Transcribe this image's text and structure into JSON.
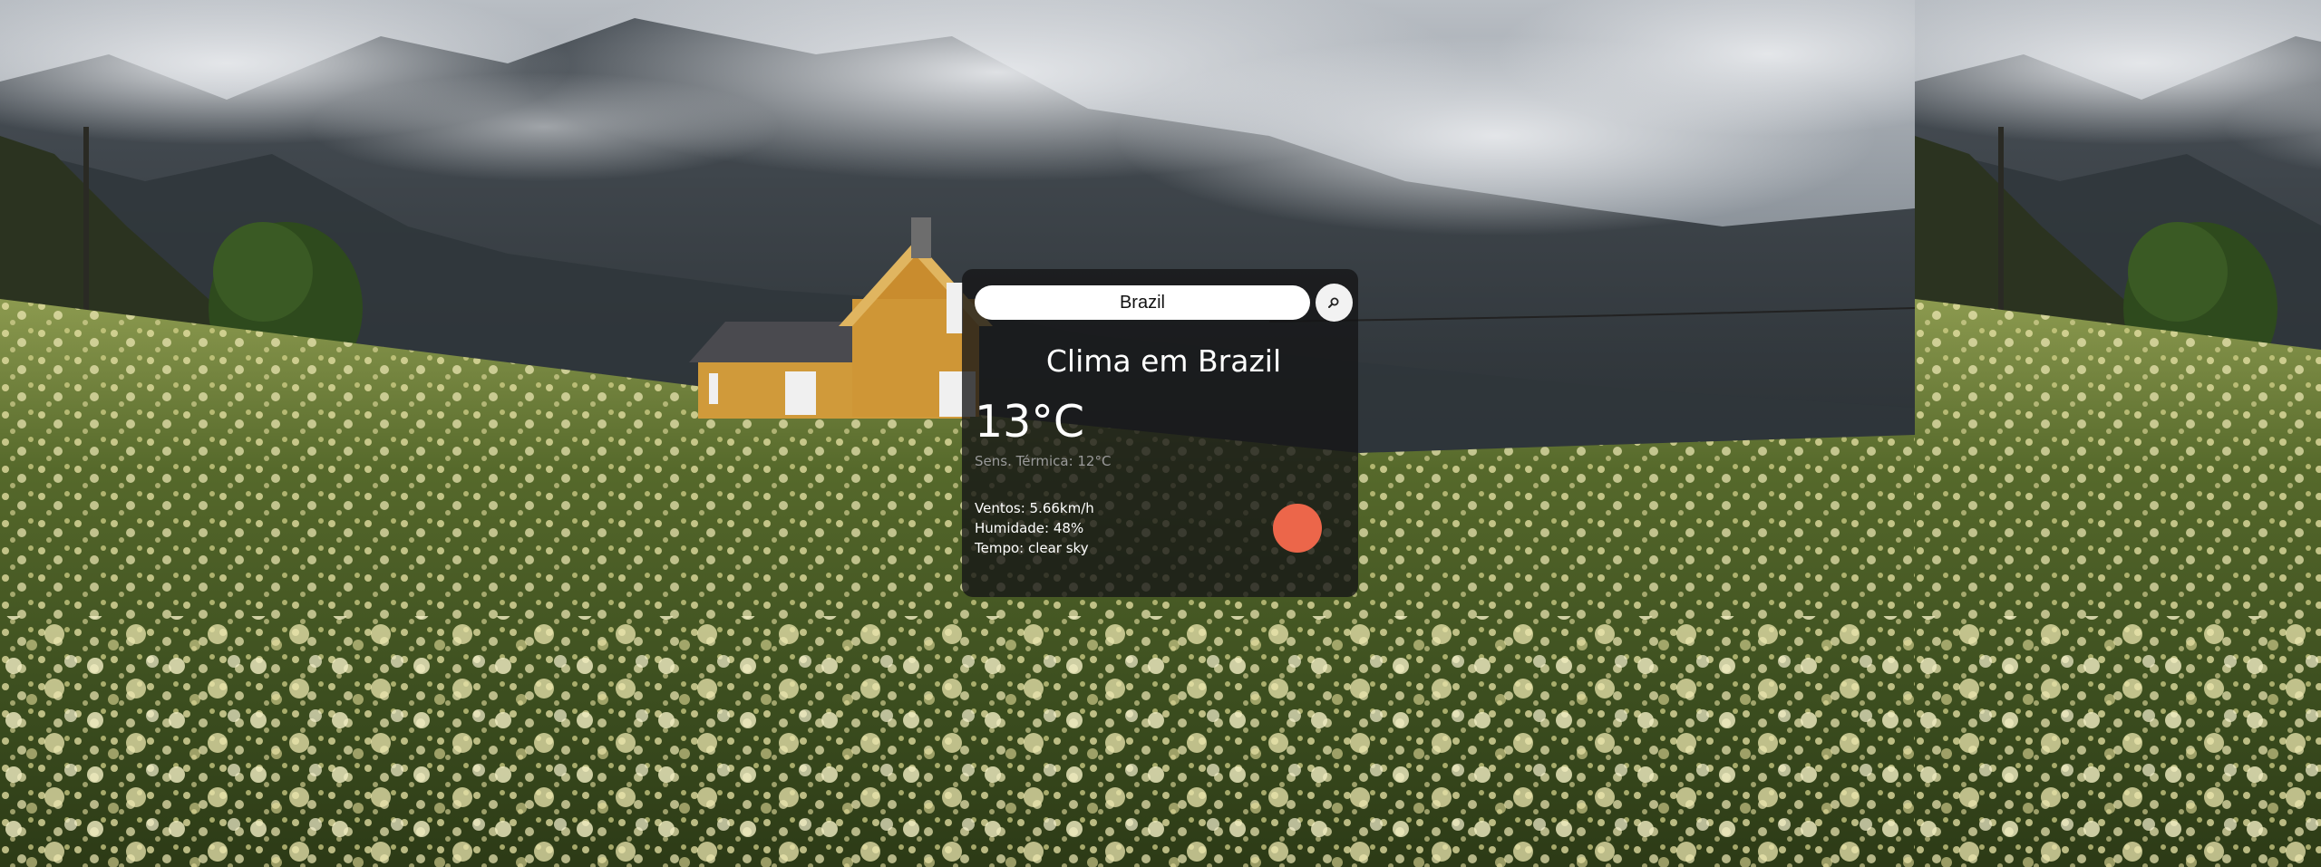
{
  "search": {
    "value": "Brazil",
    "button_icon": "search-icon"
  },
  "weather": {
    "title": "Clima em Brazil",
    "temperature": "13°C",
    "feels_like": "Sens. Térmica: 12°C",
    "wind": "Ventos: 5.66km/h",
    "humidity": "Humidade: 48%",
    "condition": "Tempo: clear sky",
    "icon": "sun-icon"
  },
  "colors": {
    "card_bg": "#141416",
    "icon_color": "#ec664a",
    "secondary_text": "#9a9a9a"
  }
}
